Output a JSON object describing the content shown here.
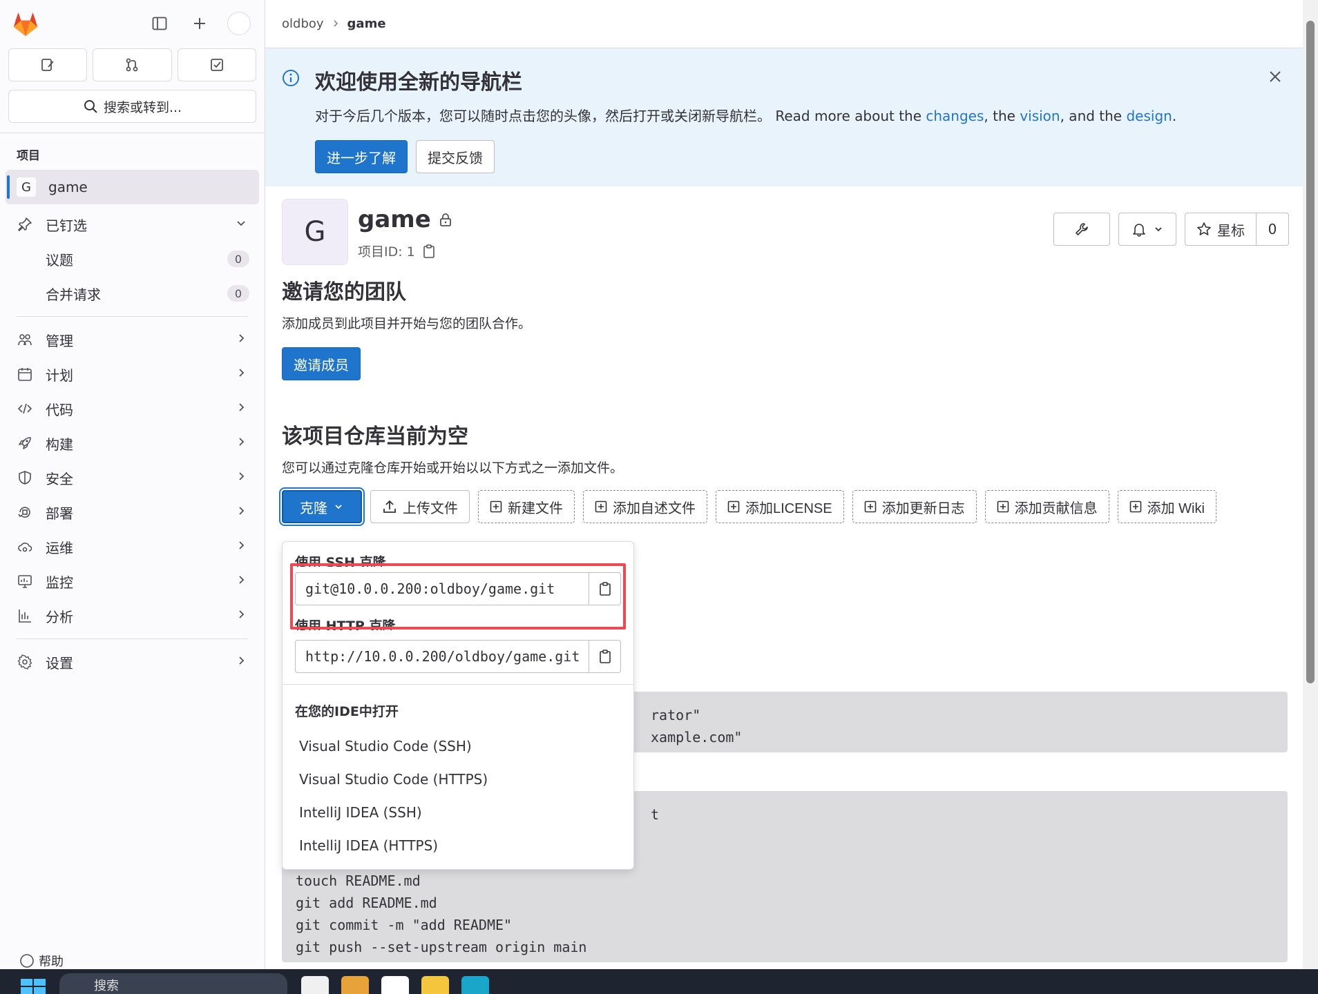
{
  "breadcrumb": {
    "parent": "oldboy",
    "current": "game"
  },
  "sidebar": {
    "search_label": "搜索或转到...",
    "section_title": "项目",
    "project": {
      "letter": "G",
      "name": "game"
    },
    "pinned": {
      "label": "已钉选",
      "items": [
        {
          "label": "议题",
          "count": "0"
        },
        {
          "label": "合并请求",
          "count": "0"
        }
      ]
    },
    "nav": [
      {
        "label": "管理",
        "icon": "users-icon"
      },
      {
        "label": "计划",
        "icon": "calendar-icon"
      },
      {
        "label": "代码",
        "icon": "code-icon"
      },
      {
        "label": "构建",
        "icon": "rocket-icon"
      },
      {
        "label": "安全",
        "icon": "shield-icon"
      },
      {
        "label": "部署",
        "icon": "deployments-icon"
      },
      {
        "label": "运维",
        "icon": "cloud-gear-icon"
      },
      {
        "label": "监控",
        "icon": "monitor-icon"
      },
      {
        "label": "分析",
        "icon": "chart-icon"
      }
    ],
    "settings_label": "设置",
    "help_label": "帮助"
  },
  "banner": {
    "title": "欢迎使用全新的导航栏",
    "text_prefix": "对于今后几个版本，您可以随时点击您的头像，然后打开或关闭新导航栏。 Read more about the ",
    "link_changes": "changes",
    "sep1": ", the ",
    "link_vision": "vision",
    "sep2": ", and the ",
    "link_design": "design",
    "suffix": ".",
    "learn_more": "进一步了解",
    "feedback": "提交反馈"
  },
  "project": {
    "letter": "G",
    "name": "game",
    "id_label": "项目ID: 1",
    "star_label": "星标",
    "star_count": "0"
  },
  "invite": {
    "title": "邀请您的团队",
    "desc": "添加成员到此项目并开始与您的团队合作。",
    "button": "邀请成员"
  },
  "empty_repo": {
    "title": "该项目仓库当前为空",
    "desc": "您可以通过克隆仓库开始或开始以以下方式之一添加文件。"
  },
  "toolbar": {
    "clone": "克隆",
    "upload": "上传文件",
    "new_file": "新建文件",
    "add_readme": "添加自述文件",
    "add_license": "添加LICENSE",
    "add_changelog": "添加更新日志",
    "add_contributing": "添加贡献信息",
    "add_wiki": "添加 Wiki"
  },
  "clone_dropdown": {
    "ssh_label": "使用 SSH 克隆",
    "ssh_url": "git@10.0.0.200:oldboy/game.git",
    "http_label": "使用 HTTP 克隆",
    "http_url": "http://10.0.0.200/oldboy/game.git",
    "ide_heading": "在您的IDE中打开",
    "ide_items": [
      "Visual Studio Code (SSH)",
      "Visual Studio Code (HTTPS)",
      "IntelliJ IDEA (SSH)",
      "IntelliJ IDEA (HTTPS)"
    ]
  },
  "code_blocks": {
    "config_line1": "rator\"",
    "config_line2": "xample.com\"",
    "repo_line1": "t",
    "repo_line2": "touch README.md",
    "repo_line3": "git add README.md",
    "repo_line4": "git commit -m \"add README\"",
    "repo_line5": "git push --set-upstream origin main"
  },
  "taskbar": {
    "search_label": "搜索"
  },
  "colors": {
    "accent": "#1f75cb",
    "highlight": "#ec4953",
    "banner_bg": "#e9f3fc"
  }
}
